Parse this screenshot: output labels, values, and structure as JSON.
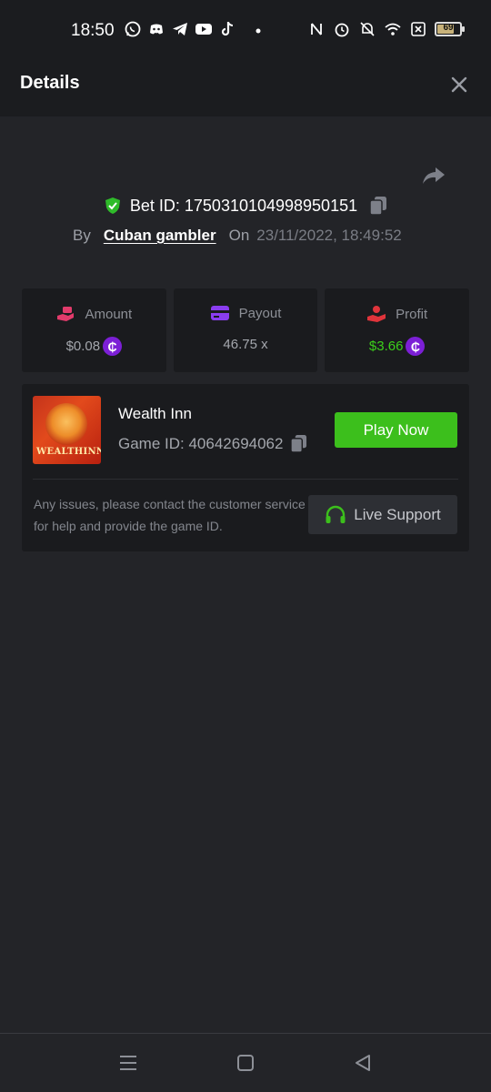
{
  "status_bar": {
    "time": "18:50",
    "battery_level": "69",
    "left_icons": [
      "whatsapp-icon",
      "discord-icon",
      "telegram-icon",
      "youtube-icon",
      "tiktok-icon",
      "dot-icon"
    ],
    "right_icons": [
      "nfc-icon",
      "alarm-icon",
      "mute-icon",
      "wifi-icon",
      "sim-off-icon",
      "battery-icon"
    ]
  },
  "header": {
    "title": "Details"
  },
  "bet": {
    "id_text": "Bet ID: 1750310104998950151",
    "by_label": "By",
    "username": "Cuban gambler",
    "on_label": "On",
    "date": "23/11/2022, 18:49:52"
  },
  "stats": {
    "amount": {
      "label": "Amount",
      "value": "$0.08"
    },
    "payout": {
      "label": "Payout",
      "value": "46.75 x"
    },
    "profit": {
      "label": "Profit",
      "value": "$3.66"
    }
  },
  "coin_symbol": "₵",
  "game": {
    "name": "Wealth Inn",
    "id_text": "Game ID: 40642694062",
    "thumb_title": "WEALTHINN",
    "play_label": "Play Now",
    "help_text": "Any issues, please contact the customer service for help and provide the game ID.",
    "support_label": "Live Support"
  },
  "colors": {
    "background": "#232428",
    "panel": "#1a1b1e",
    "accent_green": "#3cbf1c",
    "profit_green": "#3ccf1b",
    "coin_purple": "#7c1fd6"
  }
}
